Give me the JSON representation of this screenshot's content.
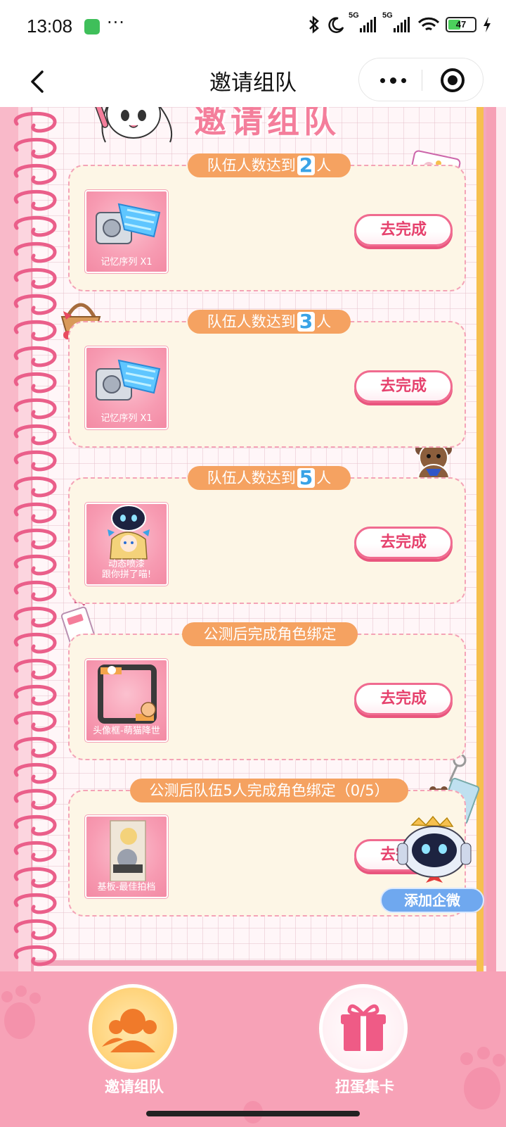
{
  "status_bar": {
    "time": "13:08",
    "dots": "···",
    "signal_1": "5G",
    "signal_2": "5G",
    "battery": "47"
  },
  "nav": {
    "title": "邀请组队"
  },
  "header": {
    "title": "邀请组队"
  },
  "tasks": [
    {
      "pill_prefix": "队伍人数达到",
      "pill_num": "2",
      "pill_suffix": "人",
      "reward_label": "记忆序列 X1",
      "button": "去完成"
    },
    {
      "pill_prefix": "队伍人数达到",
      "pill_num": "3",
      "pill_suffix": "人",
      "reward_label": "记忆序列 X1",
      "button": "去完成"
    },
    {
      "pill_prefix": "队伍人数达到",
      "pill_num": "5",
      "pill_suffix": "人",
      "reward_label_1": "动态喷漆",
      "reward_label_2": "跟你拼了喵!",
      "button": "去完成"
    },
    {
      "pill_text": "公测后完成角色绑定",
      "reward_label": "头像框-萌猫降世",
      "button": "去完成"
    },
    {
      "pill_text": "公测后队伍5人完成角色绑定（0/5）",
      "reward_label": "基板-最佳拍档",
      "button": "去完成"
    }
  ],
  "wecom_button": "添加企微",
  "tabs": [
    {
      "label": "邀请组队"
    },
    {
      "label": "扭蛋集卡"
    }
  ],
  "colors": {
    "accent_pink": "#f06b90",
    "pill_orange": "#f5a261",
    "tab_bar": "#f7a2b7",
    "wecom_blue": "#6fa8ef"
  }
}
